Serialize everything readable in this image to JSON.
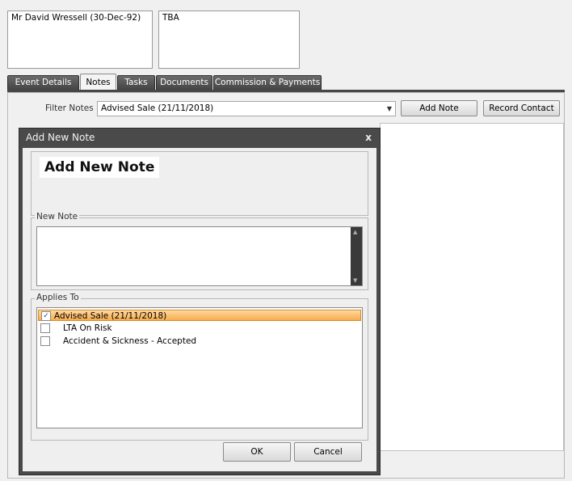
{
  "header": {
    "client_name": "Mr David Wressell (30-Dec-92)",
    "secondary": "TBA"
  },
  "tabs": [
    {
      "label": "Event Details"
    },
    {
      "label": "Notes"
    },
    {
      "label": "Tasks"
    },
    {
      "label": "Documents"
    },
    {
      "label": "Commission & Payments"
    }
  ],
  "notes_panel": {
    "filter_label": "Filter Notes",
    "filter_value": "Advised Sale (21/11/2018)",
    "add_note_label": "Add Note",
    "record_contact_label": "Record Contact"
  },
  "dialog": {
    "title": "Add New Note",
    "close_glyph": "x",
    "heading": "Add New Note",
    "new_note_legend": "New Note",
    "new_note_value": "",
    "applies_to_legend": "Applies To",
    "applies_items": [
      {
        "label": "Advised Sale (21/11/2018)",
        "checked": true
      },
      {
        "label": "LTA On Risk",
        "checked": false
      },
      {
        "label": "Accident & Sickness - Accepted",
        "checked": false
      }
    ],
    "ok_label": "OK",
    "cancel_label": "Cancel"
  },
  "colors": {
    "selected_row": "#f8ac4c",
    "dialog_frame": "#4a4a4a",
    "tab_bar": "#474747"
  }
}
